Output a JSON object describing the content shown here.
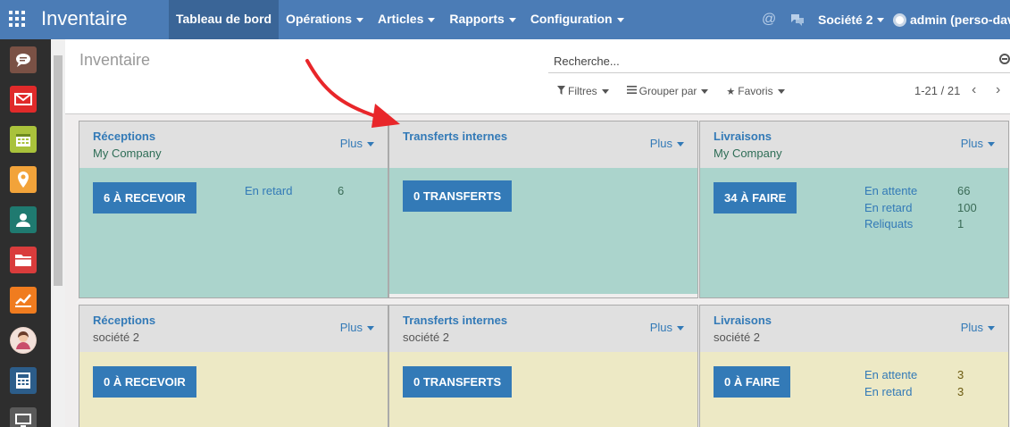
{
  "header": {
    "app_title": "Inventaire",
    "menu": [
      {
        "label": "Tableau de bord"
      },
      {
        "label": "Opérations"
      },
      {
        "label": "Articles"
      },
      {
        "label": "Rapports"
      },
      {
        "label": "Configuration"
      }
    ],
    "company": "Société 2",
    "user": "admin (perso-david"
  },
  "sidebar_apps": [
    {
      "icon": "chat-icon",
      "color": "#7a5145"
    },
    {
      "icon": "mail-icon",
      "color": "#e02a2a"
    },
    {
      "icon": "calendar-icon",
      "color": "#a9c23b"
    },
    {
      "icon": "map-pin-icon",
      "color": "#f2a33a"
    },
    {
      "icon": "contacts-icon",
      "color": "#1f7a70"
    },
    {
      "icon": "folder-icon",
      "color": "#d93c3c"
    },
    {
      "icon": "chart-icon",
      "color": "#f07c1f"
    },
    {
      "icon": "avatar-icon",
      "color": "#e8d0c6"
    },
    {
      "icon": "calculator-icon",
      "color": "#2c5d8a"
    },
    {
      "icon": "monitor-icon",
      "color": "#5a5a5a"
    }
  ],
  "control_panel": {
    "breadcrumb": "Inventaire",
    "search_placeholder": "Recherche...",
    "filters_label": "Filtres",
    "group_by_label": "Grouper par",
    "favorites_label": "Favoris",
    "pager": "1-21 / 21"
  },
  "cards": [
    {
      "title": "Réceptions",
      "company": "My Company",
      "more": "Plus",
      "action": "6 À RECEVOIR",
      "theme": "green",
      "stats": [
        {
          "label": "En retard",
          "value": "6"
        }
      ]
    },
    {
      "title": "Transferts internes",
      "company": "",
      "more": "Plus",
      "action": "0 TRANSFERTS",
      "theme": "green",
      "stats": []
    },
    {
      "title": "Livraisons",
      "company": "My Company",
      "more": "Plus",
      "action": "34 À FAIRE",
      "theme": "green",
      "stats": [
        {
          "label": "En attente",
          "value": "66"
        },
        {
          "label": "En retard",
          "value": "100"
        },
        {
          "label": "Reliquats",
          "value": "1"
        }
      ]
    },
    {
      "title": "Réceptions",
      "company": "société 2",
      "more": "Plus",
      "action": "0 À RECEVOIR",
      "theme": "yellow",
      "stats": []
    },
    {
      "title": "Transferts internes",
      "company": "société 2",
      "more": "Plus",
      "action": "0 TRANSFERTS",
      "theme": "yellow",
      "stats": []
    },
    {
      "title": "Livraisons",
      "company": "société 2",
      "more": "Plus",
      "action": "0 À FAIRE",
      "theme": "yellow",
      "stats": [
        {
          "label": "En attente",
          "value": "3"
        },
        {
          "label": "En retard",
          "value": "3"
        }
      ]
    }
  ],
  "colors": {
    "navbar": "#4b7cb6",
    "accent": "#337ab7",
    "card_green": "#abd4cc",
    "card_yellow": "#ede9c5",
    "annotation_arrow": "#e8262a"
  }
}
